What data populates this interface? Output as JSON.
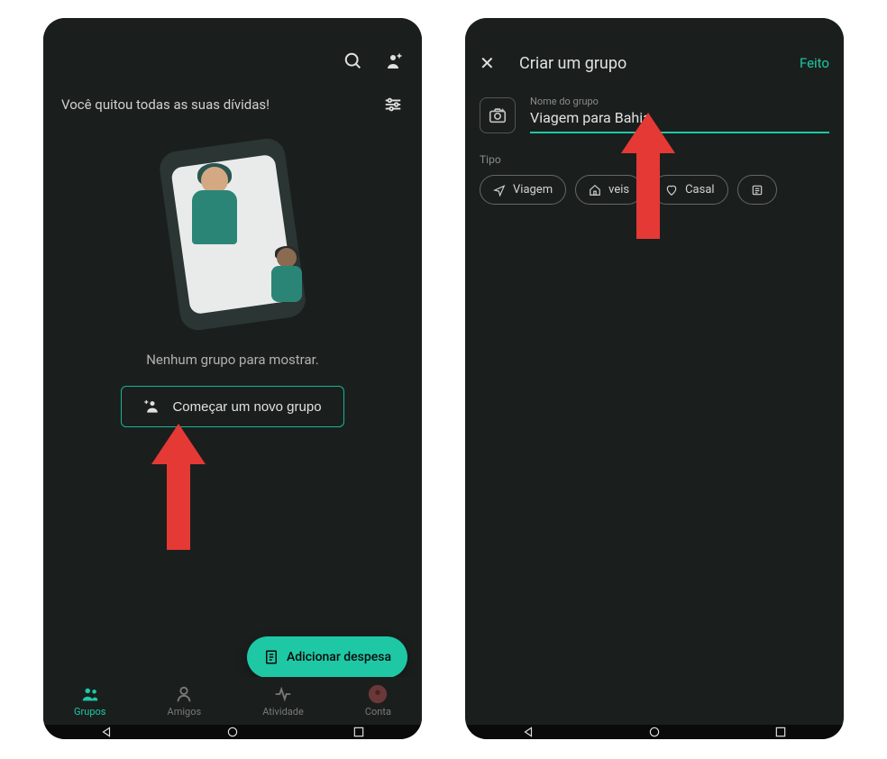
{
  "screen1": {
    "settled_text": "Você quitou todas as suas dívidas!",
    "empty_text": "Nenhum grupo para mostrar.",
    "start_group_button": "Começar um novo grupo",
    "fab_label": "Adicionar despesa",
    "nav": {
      "groups": "Grupos",
      "friends": "Amigos",
      "activity": "Atividade",
      "account": "Conta"
    }
  },
  "screen2": {
    "title": "Criar um grupo",
    "done": "Feito",
    "group_name_label": "Nome do grupo",
    "group_name_value": "Viagem para Bahia",
    "type_label": "Tipo",
    "chips": {
      "trip": "Viagem",
      "home": "veis",
      "couple": "Casal"
    }
  }
}
